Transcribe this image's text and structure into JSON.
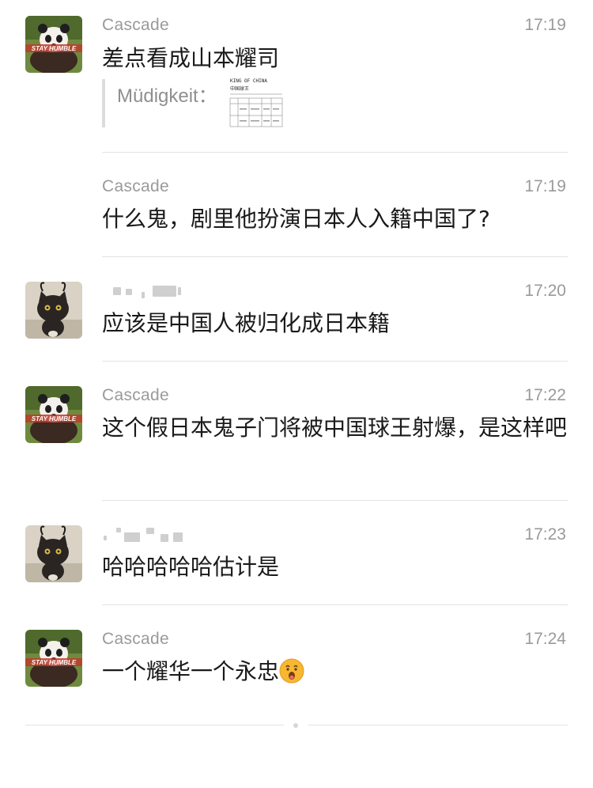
{
  "messages": [
    {
      "sender": "Cascade",
      "time": "17:19",
      "text": "差点看成山本耀司",
      "quote": {
        "name": "Müdigkeit：",
        "thumb_title": "KING OF CHINA",
        "thumb_subtitle": "中国球王"
      }
    },
    {
      "sender": "Cascade",
      "time": "17:19",
      "text": "什么鬼，剧里他扮演日本人入籍中国了?"
    },
    {
      "sender": "",
      "time": "17:20",
      "text": "应该是中国人被归化成日本籍"
    },
    {
      "sender": "Cascade",
      "time": "17:22",
      "text": "这个假日本鬼子门将被中国球王射爆，是这样吧"
    },
    {
      "sender": "",
      "time": "17:23",
      "text": "哈哈哈哈哈估计是"
    },
    {
      "sender": "Cascade",
      "time": "17:24",
      "text": "一个耀华一个永忠",
      "emoji": "astonished-face-icon"
    }
  ],
  "avatar_badge": "STAY HUMBLE",
  "colors": {
    "meta_text": "#9a9a9a",
    "body_text": "#1a1a1a",
    "divider": "#e3e3e3",
    "quote_bar": "#dcdcdc"
  }
}
